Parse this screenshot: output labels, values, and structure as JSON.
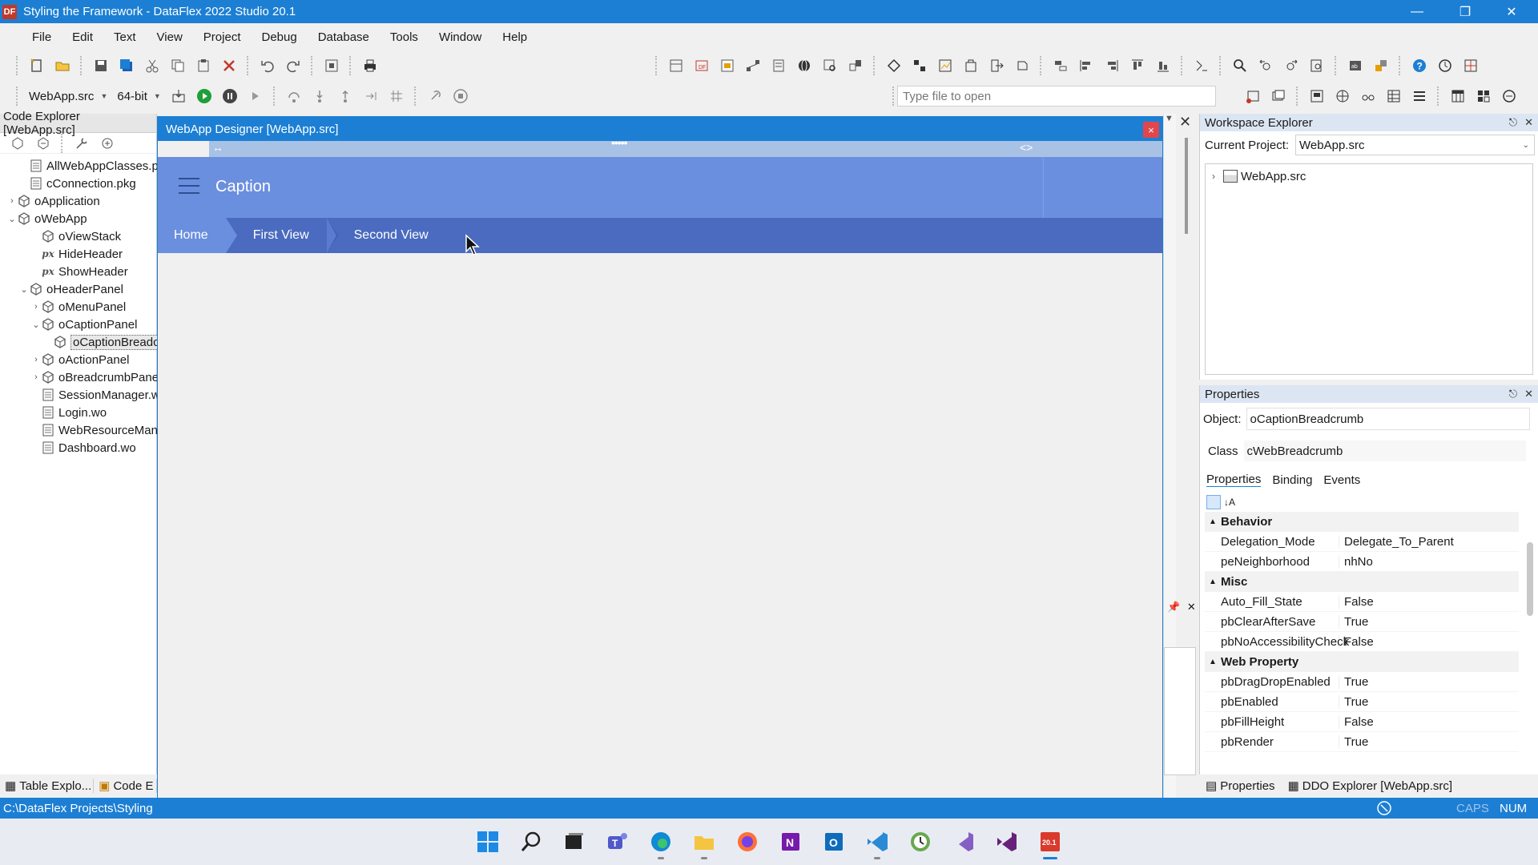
{
  "window": {
    "title": "Styling the Framework - DataFlex 2022 Studio 20.1",
    "logo_text": "DF"
  },
  "menu": [
    "File",
    "Edit",
    "Text",
    "View",
    "Project",
    "Debug",
    "Database",
    "Tools",
    "Window",
    "Help"
  ],
  "toolbar": {
    "project_combo": "WebApp.src",
    "bitness_combo": "64-bit",
    "file_open_placeholder": "Type file to open"
  },
  "code_explorer": {
    "title": "Code Explorer [WebApp.src]",
    "tree": [
      {
        "label": "AllWebAppClasses.pkg",
        "icon": "file-icon",
        "expander": ""
      },
      {
        "label": "cConnection.pkg",
        "icon": "file-icon",
        "expander": ""
      },
      {
        "label": "oApplication",
        "icon": "object-icon",
        "expander": "›"
      },
      {
        "label": "oWebApp",
        "icon": "object-icon",
        "expander": "⌄"
      },
      {
        "label": "oViewStack",
        "icon": "object-icon",
        "expander": ""
      },
      {
        "label": "HideHeader",
        "icon": "procedure-icon",
        "expander": ""
      },
      {
        "label": "ShowHeader",
        "icon": "procedure-icon",
        "expander": ""
      },
      {
        "label": "oHeaderPanel",
        "icon": "object-icon",
        "expander": "⌄"
      },
      {
        "label": "oMenuPanel",
        "icon": "object-icon",
        "expander": "›"
      },
      {
        "label": "oCaptionPanel",
        "icon": "object-icon",
        "expander": "⌄"
      },
      {
        "label": "oCaptionBreadcrumb",
        "icon": "object-icon",
        "expander": "",
        "selected": true
      },
      {
        "label": "oActionPanel",
        "icon": "object-icon",
        "expander": "›"
      },
      {
        "label": "oBreadcrumbPanel",
        "icon": "object-icon",
        "expander": "›"
      },
      {
        "label": "SessionManager.wo",
        "icon": "file-icon",
        "expander": ""
      },
      {
        "label": "Login.wo",
        "icon": "file-icon",
        "expander": ""
      },
      {
        "label": "WebResourceManager.wo",
        "icon": "file-icon",
        "expander": ""
      },
      {
        "label": "Dashboard.wo",
        "icon": "file-icon",
        "expander": ""
      }
    ],
    "bottom_tabs": [
      "Table Explo...",
      "Code E"
    ]
  },
  "designer": {
    "title": "WebApp Designer [WebApp.src]",
    "close_label": "×",
    "caption": "Caption",
    "breadcrumbs": [
      "Home",
      "First View",
      "Second View"
    ]
  },
  "workspace": {
    "title": "Workspace Explorer",
    "current_project_label": "Current Project:",
    "current_project": "WebApp.src",
    "tree_root": "WebApp.src"
  },
  "properties": {
    "title": "Properties",
    "object_label": "Object:",
    "object_value": "oCaptionBreadcrumb",
    "class_label": "Class",
    "class_value": "cWebBreadcrumb",
    "tabs": [
      "Properties",
      "Binding",
      "Events"
    ],
    "categories": [
      {
        "name": "Behavior",
        "rows": [
          {
            "name": "Delegation_Mode",
            "value": "Delegate_To_Parent"
          },
          {
            "name": "peNeighborhood",
            "value": "nhNo"
          }
        ]
      },
      {
        "name": "Misc",
        "rows": [
          {
            "name": "Auto_Fill_State",
            "value": "False"
          },
          {
            "name": "pbClearAfterSave",
            "value": "True"
          },
          {
            "name": "pbNoAccessibilityCheck",
            "value": "False"
          }
        ]
      },
      {
        "name": "Web Property",
        "rows": [
          {
            "name": "pbDragDropEnabled",
            "value": "True"
          },
          {
            "name": "pbEnabled",
            "value": "True"
          },
          {
            "name": "pbFillHeight",
            "value": "False"
          },
          {
            "name": "pbRender",
            "value": "True"
          }
        ]
      }
    ],
    "bottom_tabs": [
      "Properties",
      "DDO Explorer [WebApp.src]"
    ]
  },
  "statusbar": {
    "path": "C:\\DataFlex Projects\\Styling t",
    "caps": "CAPS",
    "num": "NUM"
  },
  "colors": {
    "accent": "#1c7fd4",
    "header_panel": "#6b8fdf",
    "breadcrumb_bar": "#4a6bbf"
  }
}
